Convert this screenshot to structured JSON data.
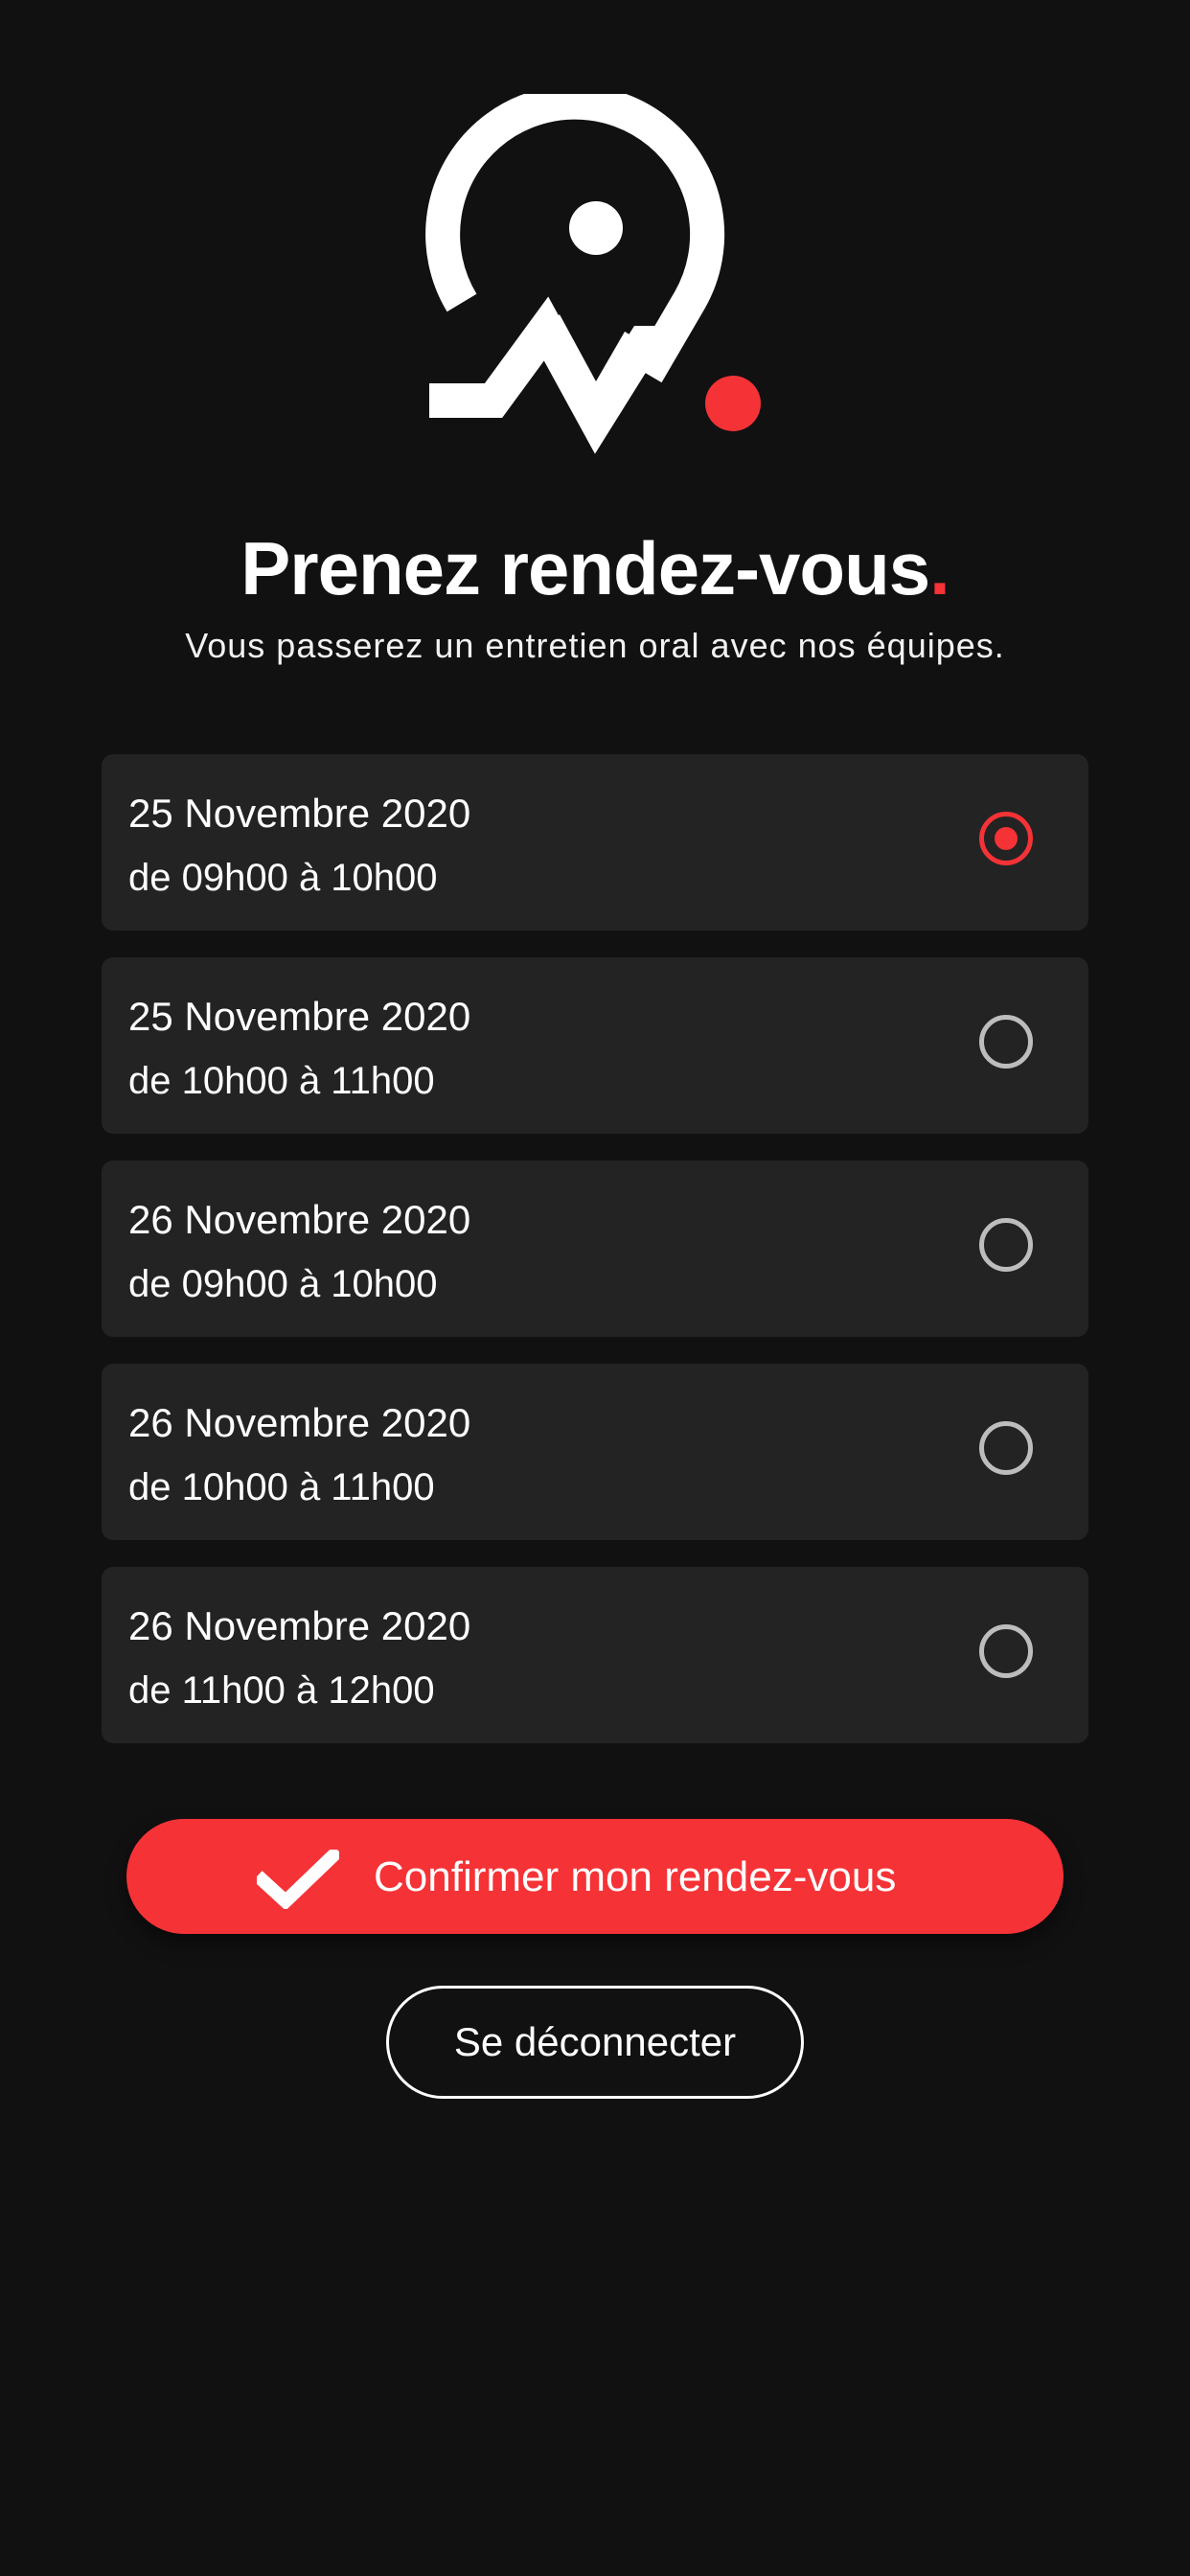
{
  "header": {
    "title": "Prenez rendez-vous",
    "title_dot": ".",
    "subtitle": "Vous passerez un entretien oral avec nos équipes."
  },
  "logo": {
    "icon": "map-pin-pulse-logo",
    "color": "#ffffff",
    "accent": "#f53236"
  },
  "slots": [
    {
      "date": "25 Novembre 2020",
      "time": "de 09h00 à 10h00",
      "selected": true
    },
    {
      "date": "25 Novembre 2020",
      "time": "de 10h00 à 11h00",
      "selected": false
    },
    {
      "date": "26 Novembre 2020",
      "time": "de 09h00 à 10h00",
      "selected": false
    },
    {
      "date": "26 Novembre 2020",
      "time": "de 10h00 à 11h00",
      "selected": false
    },
    {
      "date": "26 Novembre 2020",
      "time": "de 11h00 à 12h00",
      "selected": false
    }
  ],
  "actions": {
    "confirm_label": "Confirmer mon rendez-vous",
    "confirm_icon": "check-icon",
    "logout_label": "Se déconnecter"
  },
  "colors": {
    "background": "#111112",
    "card": "#232324",
    "accent": "#f53236",
    "radio_unchecked": "#bdbdbd",
    "text": "#ffffff"
  }
}
